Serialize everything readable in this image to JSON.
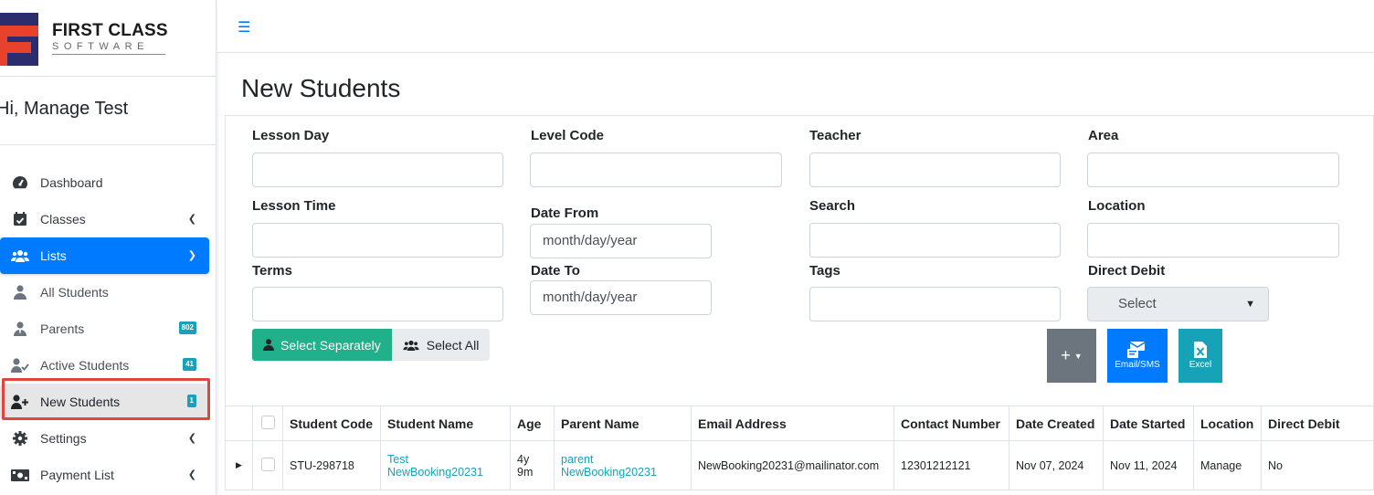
{
  "brand": {
    "name": "FIRST CLASS",
    "sub": "SOFTWARE"
  },
  "user": {
    "greeting": "Hi, Manage Test"
  },
  "nav": {
    "dashboard": "Dashboard",
    "classes": "Classes",
    "lists": "Lists",
    "all_students": "All Students",
    "parents": "Parents",
    "parents_badge": "802",
    "active_students": "Active Students",
    "active_badge": "41",
    "new_students": "New Students",
    "new_badge": "1",
    "settings": "Settings",
    "payment_list": "Payment List"
  },
  "page": {
    "title": "New Students"
  },
  "filters": {
    "lesson_day": "Lesson Day",
    "level_code": "Level Code",
    "teacher": "Teacher",
    "area": "Area",
    "lesson_time": "Lesson Time",
    "date_from": "Date From",
    "date_from_value": "month/day/year",
    "search": "Search",
    "location": "Location",
    "terms": "Terms",
    "date_to": "Date To",
    "date_to_value": "month/day/year",
    "tags": "Tags",
    "direct_debit": "Direct Debit",
    "direct_debit_value": "Select"
  },
  "buttons": {
    "select_separately": "Select Separately",
    "select_all": "Select All",
    "plus": "+",
    "email_sms": "Email/SMS",
    "excel": "Excel"
  },
  "table": {
    "headers": [
      "Student Code",
      "Student Name",
      "Age",
      "Parent Name",
      "Email Address",
      "Contact Number",
      "Date Created",
      "Date Started",
      "Location",
      "Direct Debit"
    ],
    "rows": [
      {
        "student_code": "STU-298718",
        "student_name_1": "Test",
        "student_name_2": "NewBooking20231",
        "age_1": "4y",
        "age_2": "9m",
        "parent_name_1": "parent",
        "parent_name_2": "NewBooking20231",
        "email": "NewBooking20231@mailinator.com",
        "contact": "12301212121",
        "date_created": "Nov 07, 2024",
        "date_started": "Nov 11, 2024",
        "location": "Manage",
        "direct_debit": "No"
      }
    ]
  },
  "colors": {
    "primary": "#007bff",
    "success": "#20b08a",
    "info": "#17a2b8",
    "secondary": "#6c757d",
    "highlight": "#e2453c",
    "logo_navy": "#2b2d6e",
    "logo_red": "#e8412c"
  }
}
